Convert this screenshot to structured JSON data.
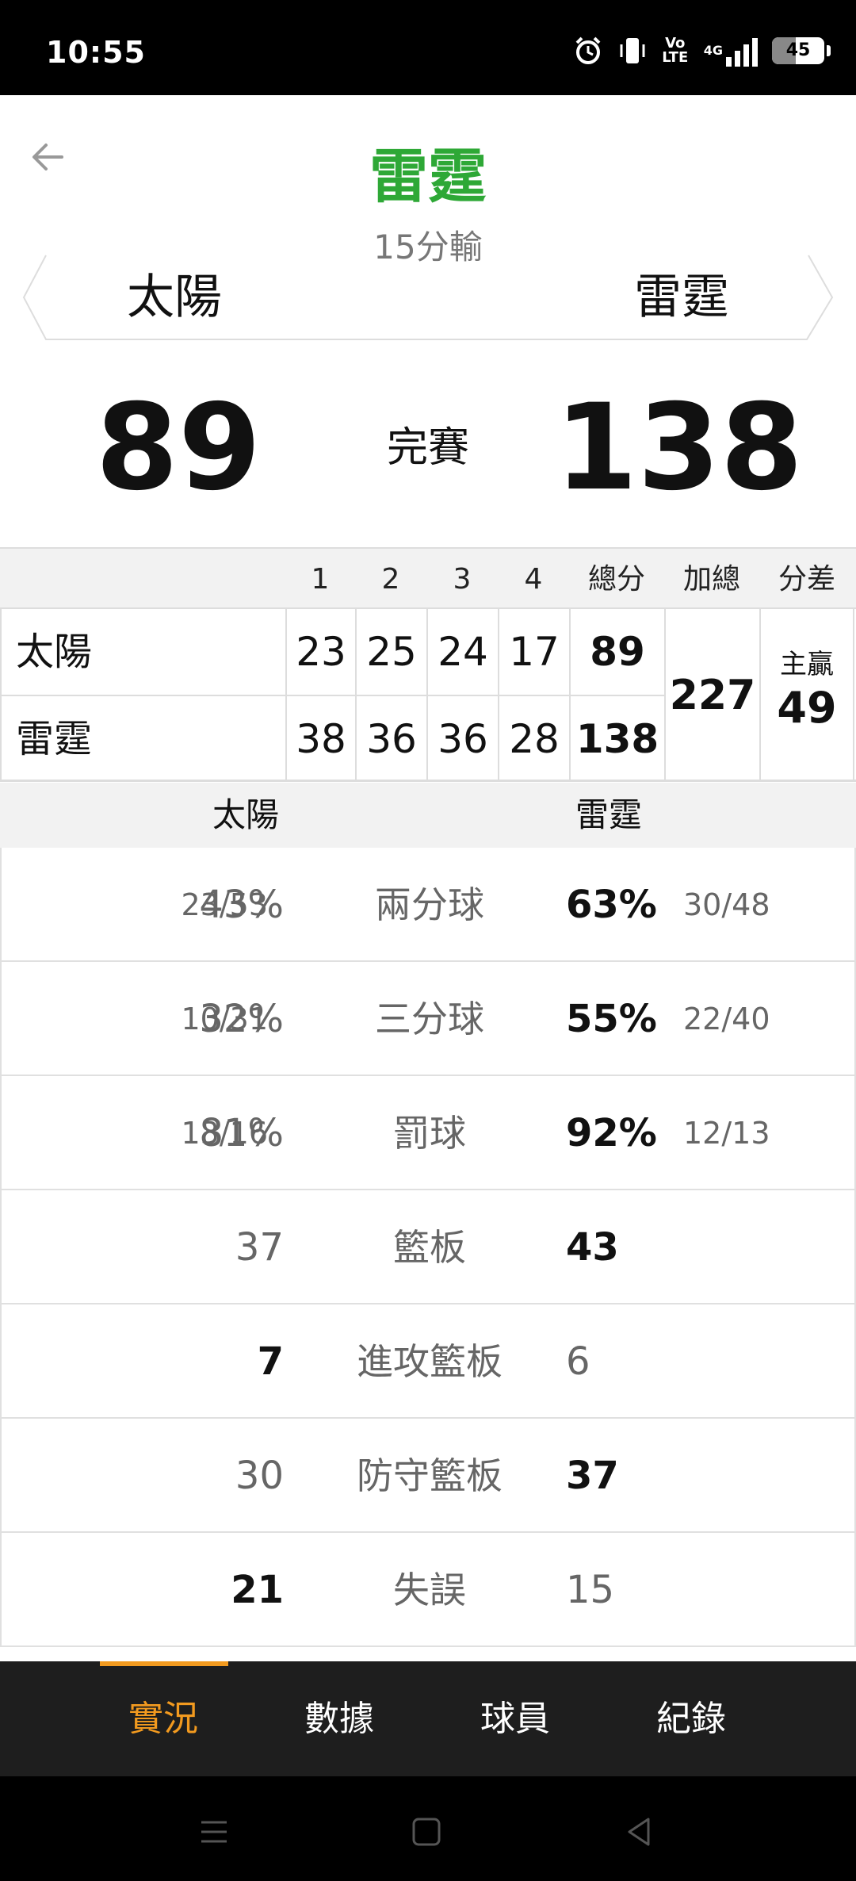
{
  "status_bar": {
    "time": "10:55",
    "network": "4G",
    "volte": "Vo LTE",
    "battery": "45",
    "battery_level": 0.45
  },
  "header": {
    "back_icon": "arrow-left-icon",
    "winner": "雷霆",
    "subtitle": "15分輸",
    "team_left": "太陽",
    "team_right": "雷霆"
  },
  "score": {
    "left": "89",
    "status": "完賽",
    "right": "138"
  },
  "quarters": {
    "headers": [
      "1",
      "2",
      "3",
      "4",
      "總分",
      "加總",
      "分差"
    ],
    "rows": [
      {
        "team": "太陽",
        "q": [
          "23",
          "25",
          "24",
          "17"
        ],
        "total": "89"
      },
      {
        "team": "雷霆",
        "q": [
          "38",
          "36",
          "36",
          "28"
        ],
        "total": "138"
      }
    ],
    "sum": "227",
    "diff_label": "主贏",
    "diff_value": "49"
  },
  "stats_header": {
    "left": "太陽",
    "right": "雷霆"
  },
  "stats": [
    {
      "label": "兩分球",
      "left_frac": "23/53",
      "left": "43%",
      "right": "63%",
      "right_frac": "30/48",
      "bold": "right"
    },
    {
      "label": "三分球",
      "left_frac": "10/31",
      "left": "32%",
      "right": "55%",
      "right_frac": "22/40",
      "bold": "right"
    },
    {
      "label": "罰球",
      "left_frac": "13/16",
      "left": "81%",
      "right": "92%",
      "right_frac": "12/13",
      "bold": "right"
    },
    {
      "label": "籃板",
      "left_frac": "",
      "left": "37",
      "right": "43",
      "right_frac": "",
      "bold": "right"
    },
    {
      "label": "進攻籃板",
      "left_frac": "",
      "left": "7",
      "right": "6",
      "right_frac": "",
      "bold": "left"
    },
    {
      "label": "防守籃板",
      "left_frac": "",
      "left": "30",
      "right": "37",
      "right_frac": "",
      "bold": "right"
    },
    {
      "label": "失誤",
      "left_frac": "",
      "left": "21",
      "right": "15",
      "right_frac": "",
      "bold": "left"
    }
  ],
  "tabs": [
    {
      "label": "實況",
      "active": true
    },
    {
      "label": "數據",
      "active": false
    },
    {
      "label": "球員",
      "active": false
    },
    {
      "label": "紀錄",
      "active": false
    }
  ],
  "colors": {
    "winner": "#2ea836",
    "accent": "#f29a1f",
    "tabbar": "#1e1e1e"
  }
}
